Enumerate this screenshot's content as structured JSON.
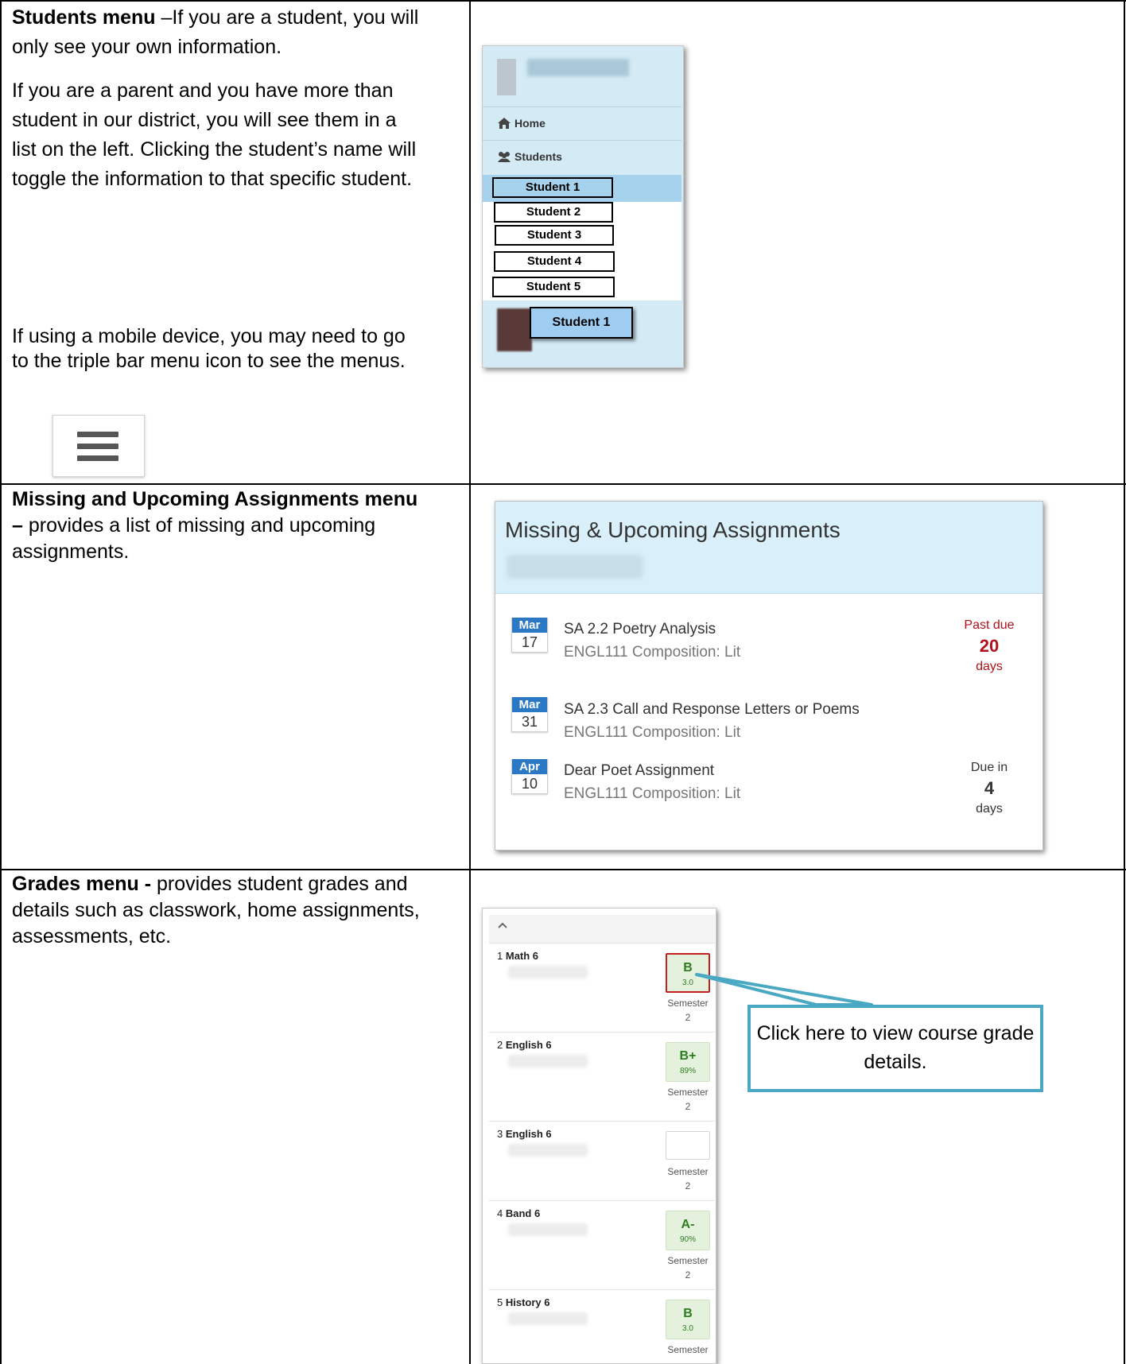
{
  "rows": {
    "students": {
      "title": "Students menu",
      "title_suffix": " –If you are a student, you will only see your own information.",
      "para2": "If you are a parent and  you have more than student in our district, you will see them in a list on the left. Clicking the student’s name will toggle the information to that specific student.",
      "para3": "If using a mobile device, you may need to go to the triple bar menu icon to see the menus."
    },
    "missing": {
      "title": "Missing and Upcoming Assignments menu –",
      "desc": " provides a list of missing and upcoming assignments."
    },
    "grades": {
      "title": "Grades menu -",
      "desc": " provides student grades and details such as classwork, home assignments, assessments, etc."
    }
  },
  "students_shot": {
    "nav": [
      {
        "label": "Home",
        "icon": "home-icon"
      },
      {
        "label": "Students",
        "icon": "users-icon"
      }
    ],
    "students": [
      "Student 1",
      "Student 2",
      "Student 3",
      "Student 4",
      "Student 5"
    ],
    "current_student": "Student 1"
  },
  "missing_shot": {
    "title": "Missing & Upcoming Assignments",
    "items": [
      {
        "month": "Mar",
        "day": "17",
        "title": "SA 2.2 Poetry Analysis",
        "course": "ENGL111 Composition: Lit",
        "status_top": "Past due",
        "status_num": "20",
        "status_unit": "days"
      },
      {
        "month": "Mar",
        "day": "31",
        "title": "SA 2.3 Call and Response Letters or Poems",
        "course": "ENGL111 Composition: Lit"
      },
      {
        "month": "Apr",
        "day": "10",
        "title": "Dear Poet Assignment",
        "course": "ENGL111 Composition: Lit",
        "status_top": "Due in",
        "status_num": "4",
        "status_unit": "days"
      }
    ],
    "colors": {
      "month_bg": "#2b78c5",
      "past_due": "#b0111a"
    }
  },
  "grades_shot": {
    "courses": [
      {
        "num": "1",
        "name": "Math 6",
        "grade": "B",
        "score": "3.0",
        "term": "Semester",
        "term_num": "2"
      },
      {
        "num": "2",
        "name": "English 6",
        "grade": "B+",
        "score": "89%",
        "term": "Semester",
        "term_num": "2"
      },
      {
        "num": "3",
        "name": "English 6",
        "grade": "",
        "score": "",
        "term": "Semester",
        "term_num": "2"
      },
      {
        "num": "4",
        "name": "Band 6",
        "grade": "A-",
        "score": "90%",
        "term": "Semester",
        "term_num": "2"
      },
      {
        "num": "5",
        "name": "History 6",
        "grade": "B",
        "score": "3.0",
        "term": "Semester",
        "term_num": ""
      }
    ],
    "callout": "Click here to view course grade details."
  }
}
